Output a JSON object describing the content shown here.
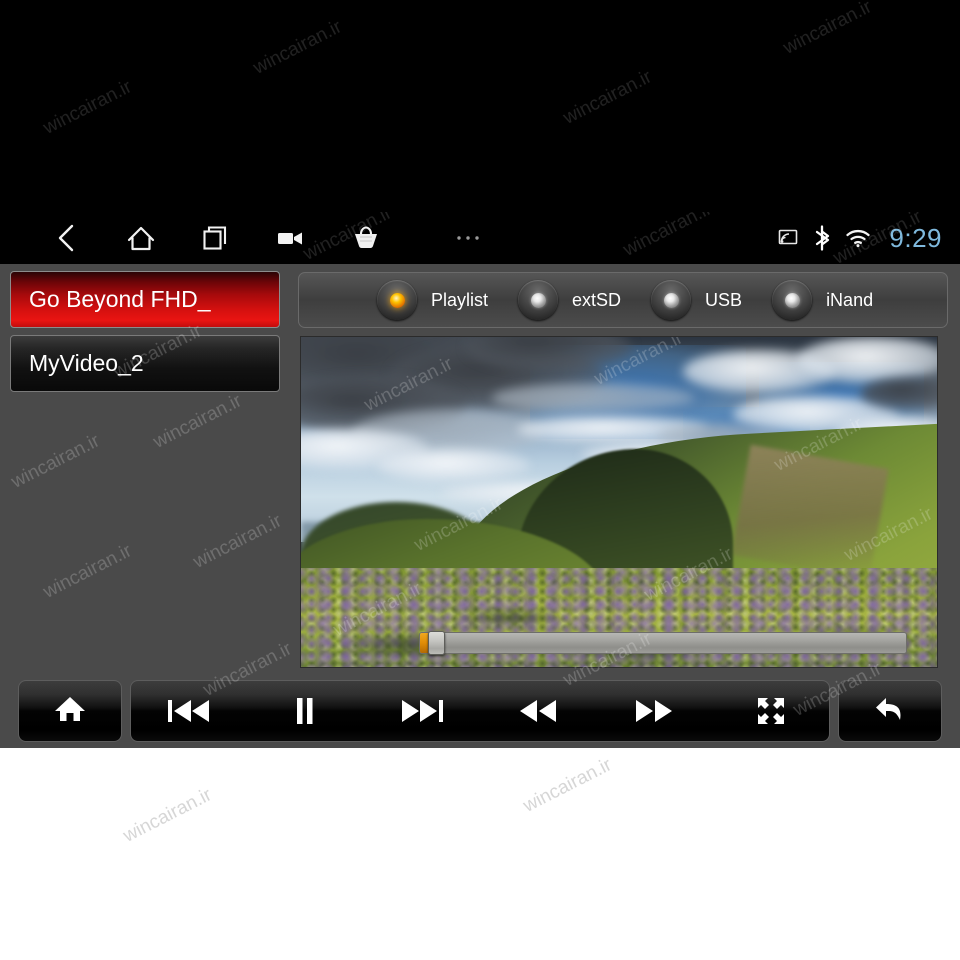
{
  "window": {
    "title": "Android Car Head Unit — Video Player",
    "watermark_text": "wincairan.ir"
  },
  "statusbar": {
    "nav_buttons": [
      {
        "name": "back-icon",
        "label": "Back"
      },
      {
        "name": "home-icon",
        "label": "Home"
      },
      {
        "name": "recent-apps-icon",
        "label": "Recent apps"
      },
      {
        "name": "screenshot-video-icon",
        "label": "Screen record"
      },
      {
        "name": "basket-icon",
        "label": "Apps basket"
      },
      {
        "name": "overflow-menu-icon",
        "label": "More"
      }
    ],
    "system_icons": [
      {
        "name": "cast-icon",
        "label": "Cast"
      },
      {
        "name": "bluetooth-icon",
        "label": "Bluetooth"
      },
      {
        "name": "wifi-icon",
        "label": "Wi-Fi"
      }
    ],
    "clock": "9:29",
    "clock_color": "#7fb9dd"
  },
  "playlist": {
    "items": [
      {
        "label": "Go Beyond FHD_",
        "selected": true
      },
      {
        "label": "MyVideo_2",
        "selected": false
      }
    ],
    "selected_color": "#e01010"
  },
  "sources": {
    "options": [
      {
        "label": "Playlist",
        "active": true
      },
      {
        "label": "extSD",
        "active": false
      },
      {
        "label": "USB",
        "active": false
      },
      {
        "label": "iNand",
        "active": false
      }
    ],
    "active_led_color": "#ffc400"
  },
  "video": {
    "scene_description": "Mountain meadow with dramatic clouded sky, distant blue ridges and green-yellow alpine slope with purple wildflowers",
    "progress_percent": 2,
    "progress_fill_color": "#e08c06"
  },
  "controls": {
    "home": {
      "name": "home-button",
      "label": "Home"
    },
    "media": [
      {
        "name": "previous-track-button",
        "label": "Previous"
      },
      {
        "name": "pause-button",
        "label": "Pause"
      },
      {
        "name": "next-track-button",
        "label": "Next"
      },
      {
        "name": "rewind-button",
        "label": "Rewind"
      },
      {
        "name": "fast-forward-button",
        "label": "Fast forward"
      },
      {
        "name": "fullscreen-button",
        "label": "Fullscreen"
      }
    ],
    "back": {
      "name": "return-button",
      "label": "Return"
    }
  }
}
